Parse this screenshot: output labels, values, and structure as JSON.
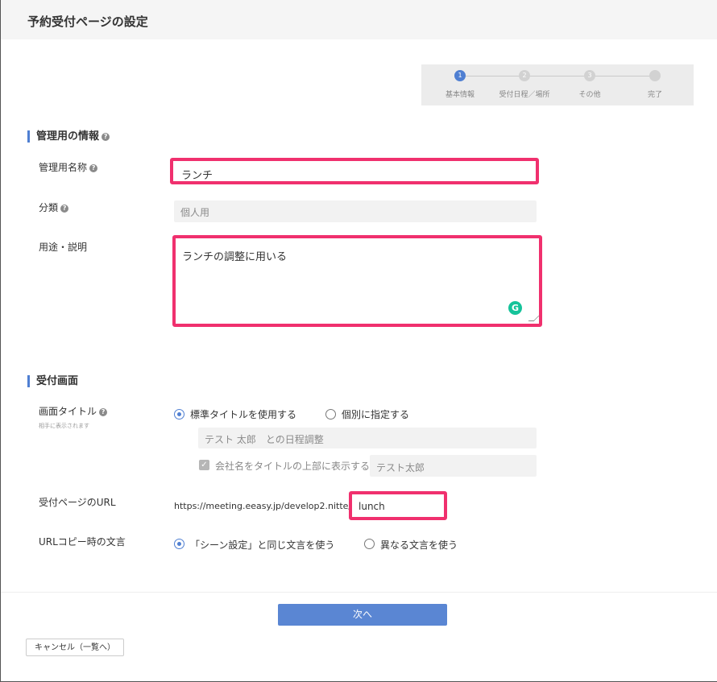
{
  "header": {
    "title": "予約受付ページの設定"
  },
  "stepper": {
    "steps": [
      {
        "number": "1",
        "label": "基本情報"
      },
      {
        "number": "2",
        "label": "受付日程／場所"
      },
      {
        "number": "3",
        "label": "その他"
      },
      {
        "number": "",
        "label": "完了"
      }
    ],
    "active_step": 1
  },
  "admin_section": {
    "heading": "管理用の情報",
    "name": {
      "label": "管理用名称",
      "value": "ランチ"
    },
    "category": {
      "label": "分類",
      "value": "個人用"
    },
    "description": {
      "label": "用途・説明",
      "value": "ランチの調整に用いる"
    }
  },
  "reception_section": {
    "heading": "受付画面",
    "screen_title": {
      "label": "画面タイトル",
      "sublabel": "相手に表示されます",
      "option_standard": "標準タイトルを使用する",
      "option_custom": "個別に指定する",
      "selected": "standard",
      "title_preview": "テスト 太郎　との日程調整",
      "show_company_label": "会社名をタイトルの上部に表示する",
      "show_company_checked": true,
      "company_value": "テスト太郎"
    },
    "url": {
      "label": "受付ページのURL",
      "prefix": "https://meeting.eeasy.jp/develop2.nitte/",
      "slug": "lunch"
    },
    "copy_text": {
      "label": "URLコピー時の文言",
      "option_same": "「シーン設定」と同じ文言を使う",
      "option_different": "異なる文言を使う",
      "selected": "same"
    }
  },
  "buttons": {
    "next": "次へ",
    "cancel": "キャンセル（一覧へ）"
  },
  "icons": {
    "help": "help-circle-icon",
    "grammarly": "grammarly-icon",
    "check": "check-icon"
  },
  "colors": {
    "accent": "#4f7fd2",
    "highlight": "#f0306e",
    "grammarly": "#15c39a"
  }
}
